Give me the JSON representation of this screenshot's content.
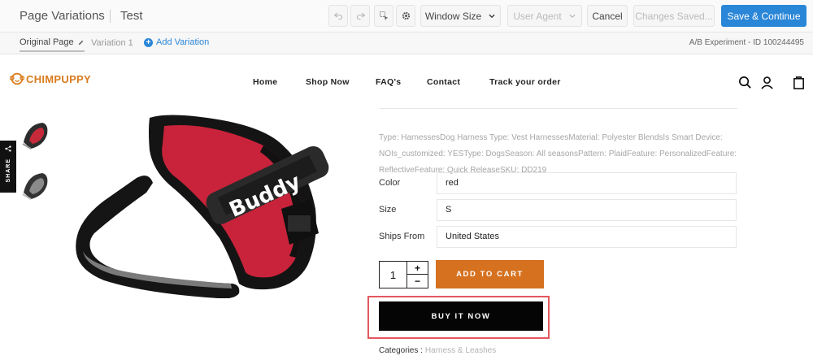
{
  "editor": {
    "title": "Page Variations",
    "test_name": "Test",
    "window_size_label": "Window Size",
    "user_agent_label": "User Agent",
    "cancel_label": "Cancel",
    "status_label": "Changes Saved...",
    "save_label": "Save & Continue",
    "icons": [
      "undo-icon",
      "redo-icon",
      "element-select-icon",
      "gear-icon",
      "chevron-down-icon"
    ]
  },
  "variations": {
    "original_label": "Original Page",
    "variation_label": "Variation 1",
    "add_label": "Add Variation",
    "experiment_id": "A/B Experiment - ID 100244495"
  },
  "site": {
    "logo_text": "CHIMPUPPY",
    "nav": [
      "Home",
      "Shop Now",
      "FAQ's",
      "Contact",
      "Track your order"
    ],
    "share_label": "SHARE",
    "product_image_text": "Buddy",
    "colors": {
      "accent": "#d5711f",
      "brand": "#d97b1e",
      "buy": "#050505",
      "highlight": "#e3585e",
      "editor_primary": "#2a86d7"
    }
  },
  "product": {
    "description": "Type: HarnessesDog Harness Type: Vest HarnessesMaterial: Polyester BlendsIs Smart Device: NOIs_customized: YESType: DogsSeason: All seasonsPattern: PlaidFeature: PersonalizedFeature: ReflectiveFeature: Quick ReleaseSKU: DD219",
    "options": [
      {
        "label": "Color",
        "value": "red"
      },
      {
        "label": "Size",
        "value": "S"
      },
      {
        "label": "Ships From",
        "value": "United States"
      }
    ],
    "quantity": "1",
    "qty_plus": "+",
    "qty_minus": "−",
    "add_to_cart": "ADD TO CART",
    "buy_now": "BUY IT NOW",
    "categories_label": "Categories :",
    "categories_value": "Harness & Leashes"
  }
}
